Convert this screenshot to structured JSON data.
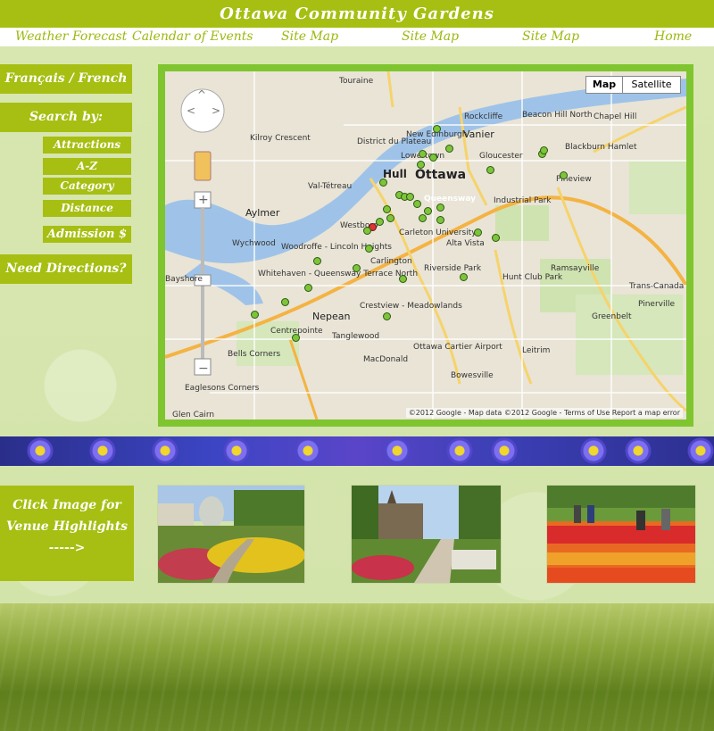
{
  "header": {
    "title": "Ottawa Community Gardens"
  },
  "nav": {
    "items": [
      "Weather Forecast",
      "Calendar of Events",
      "Site Map",
      "Site Map",
      "Site Map",
      "Home"
    ]
  },
  "sidebar": {
    "language": "Français / French",
    "search_by": "Search by:",
    "search_options": [
      "Attractions",
      "A-Z",
      "Category",
      "Distance"
    ],
    "admission": "Admission $",
    "directions": "Need Directions?"
  },
  "map": {
    "map_button": "Map",
    "satellite_button": "Satellite",
    "attribution": "©2012 Google - Map data ©2012 Google - Terms of Use  Report a map error",
    "places": {
      "touraine": "Touraine",
      "rockcliffe": "Rockcliffe",
      "beacon": "Beacon Hill North",
      "chapel": "Chapel Hill",
      "kilroy": "Kilroy Crescent",
      "district": "District du Plateau",
      "newedinburgh": "New Edinburgh",
      "vanier": "Vanier",
      "gloucester": "Gloucester",
      "blackburn": "Blackburn Hamlet",
      "hull": "Hull",
      "ottawa": "Ottawa",
      "lowertown": "Lowertown",
      "valtetreau": "Val-Tétreau",
      "aylmer": "Aylmer",
      "westboro": "Westboro",
      "industrial": "Industrial Park",
      "wychwood": "Wychwood",
      "woodroffe": "Woodroffe - Lincoln Heights",
      "carleton": "Carleton University",
      "altavista": "Alta Vista",
      "carlington": "Carlington",
      "ramsayville": "Ramsayville",
      "whitehaven": "Whitehaven - Queensway Terrace North",
      "riverside": "Riverside Park",
      "hunt": "Hunt Club Park",
      "bayshore": "Bayshore",
      "nepean": "Nepean",
      "crestview": "Crestview - Meadowlands",
      "pinerville": "Pinerville",
      "greenbelt": "Greenbelt",
      "tanglewood": "Tanglewood",
      "centrepointe": "Centrepointe",
      "bells": "Bells Corners",
      "macdonald": "MacDonald",
      "airport": "Ottawa Cartier Airport",
      "leitrim": "Leitrim",
      "bowesville": "Bowesville",
      "eaglesons": "Eaglesons Corners",
      "glencairn": "Glen Cairn",
      "queensway": "Queensway",
      "pineview": "Pineview",
      "transcanada": "Trans-Canada"
    }
  },
  "venue": {
    "line1": "Click Image for",
    "line2": "Venue Highlights",
    "arrow": "----->"
  },
  "colors": {
    "accent": "#a6bf12",
    "map_frame": "#7fc52f",
    "nav_text": "#9eb80f"
  }
}
